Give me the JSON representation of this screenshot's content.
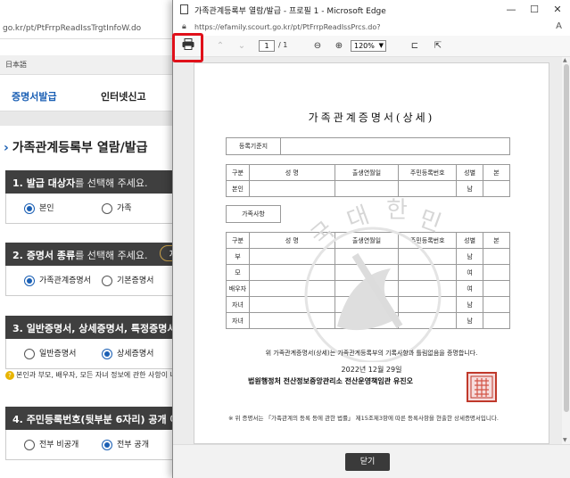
{
  "background": {
    "url": "go.kr/pt/PtFrrpReadIssTrgtInfoW.do",
    "lang": "日本語",
    "nav": [
      "증명서발급",
      "인터넷신고"
    ],
    "page_title": "가족관계등록부 열람/발급",
    "sections": [
      {
        "number": "1.",
        "bold": "발급 대상자",
        "rest": "를 선택해 주세요.",
        "options": [
          {
            "label": "본인",
            "selected": true
          },
          {
            "label": "가족",
            "selected": false
          }
        ]
      },
      {
        "number": "2.",
        "bold": "증명서 종류",
        "rest": "를 선택해 주세요.",
        "pill": "자",
        "options": [
          {
            "label": "가족관계증명서",
            "selected": true
          },
          {
            "label": "기본증명서",
            "selected": false
          }
        ]
      },
      {
        "number": "3.",
        "bold": "일반증명서, 상세증명서, 특정증명서",
        "rest": "",
        "options": [
          {
            "label": "일반증명서",
            "selected": false
          },
          {
            "label": "상세증명서",
            "selected": true
          }
        ]
      },
      {
        "number": "4.",
        "bold": "주민등록번호(뒷부분 6자리) 공개 여",
        "rest": "",
        "options": [
          {
            "label": "전부 비공개",
            "selected": false
          },
          {
            "label": "전부 공개",
            "selected": true
          }
        ]
      }
    ],
    "note": "본인과 부모, 배우자, 모든 자녀 정보에 관한 사항이 나옵"
  },
  "popup": {
    "window_title": "가족관계등록부 열람/발급 - 프로필 1 - Microsoft Edge",
    "address_url": "https://efamily.scourt.go.kr/pt/PtFrrpReadIssPrcs.do?",
    "toolbar": {
      "page_current": "1",
      "page_total": "/ 1",
      "zoom": "120%"
    },
    "document": {
      "title": "가족관계증명서(상세)",
      "reg_base_label": "등록기준지",
      "header_cols": [
        "구분",
        "성  명",
        "출생연월일",
        "주민등록번호",
        "성별",
        "본"
      ],
      "self_row": [
        "본인",
        "",
        "",
        "",
        "남",
        ""
      ],
      "family_label": "가족사항",
      "family_rows": [
        [
          "부",
          "",
          "",
          "",
          "남",
          ""
        ],
        [
          "모",
          "",
          "",
          "",
          "여",
          ""
        ],
        [
          "배우자",
          "",
          "",
          "",
          "여",
          ""
        ],
        [
          "자녀",
          "",
          "",
          "",
          "남",
          ""
        ],
        [
          "자녀",
          "",
          "",
          "",
          "남",
          ""
        ]
      ],
      "certify_text": "위 가족관계증명서(상세)는 가족관계등록부의 기록사항과 틀림없음을 증명합니다.",
      "date": "2022년 12월 29일",
      "issuer": "법원행정처 전산정보중앙관리소 전산운영책임관 유진오",
      "watermark_chars": [
        "대",
        "한",
        "민",
        "국"
      ],
      "footnote": "※ 위 증명서는 「가족관계의 등록 등에 관한 법률」 제15조제3항에 따른 등록사항을 현출한 상세증명서입니다."
    },
    "close_label": "닫기"
  }
}
